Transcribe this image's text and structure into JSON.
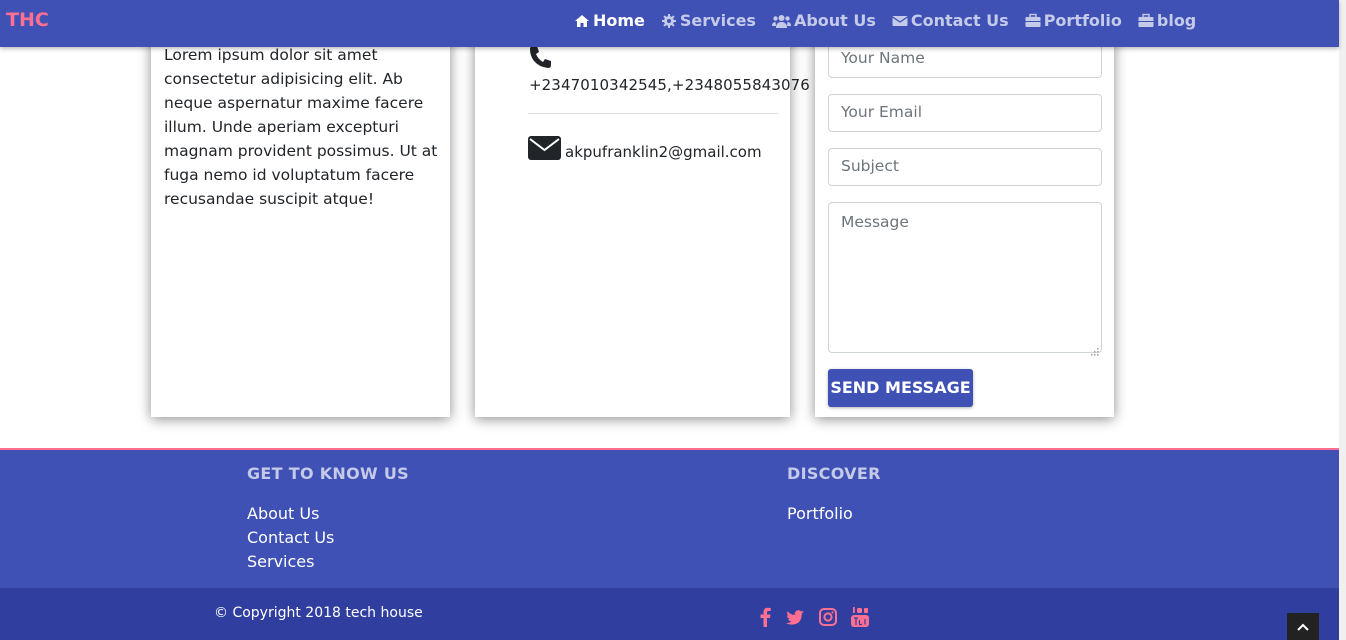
{
  "colors": {
    "primary": "#3f51b5",
    "primary_dark": "#303f9f",
    "accent": "#ff6f91",
    "nav_inactive": "#c5cae9"
  },
  "navbar": {
    "brand": "THC",
    "links": [
      {
        "label": "Home",
        "icon": "home-icon",
        "active": true
      },
      {
        "label": "Services",
        "icon": "gear-icon",
        "active": false
      },
      {
        "label": "About Us",
        "icon": "users-icon",
        "active": false
      },
      {
        "label": "Contact Us",
        "icon": "envelope-icon",
        "active": false
      },
      {
        "label": "Portfolio",
        "icon": "briefcase-icon",
        "active": false
      },
      {
        "label": "blog",
        "icon": "briefcase-icon",
        "active": false
      }
    ]
  },
  "about": {
    "text": "Lorem ipsum dolor sit amet consectetur adipisicing elit. Ab neque aspernatur maxime facere illum. Unde aperiam excepturi magnam provident possimus. Ut at fuga nemo id voluptatum facere recusandae suscipit atque!"
  },
  "contact": {
    "phone": "+2347010342545,+2348055843076",
    "email": "akpufranklin2@gmail.com"
  },
  "form": {
    "name_placeholder": "Your Name",
    "email_placeholder": "Your Email",
    "subject_placeholder": "Subject",
    "message_placeholder": "Message",
    "submit_label": "SEND MESSAGE"
  },
  "footer": {
    "col1": {
      "heading": "GET TO KNOW US",
      "links": [
        "About Us",
        "Contact Us",
        "Services"
      ]
    },
    "col2": {
      "heading": "DISCOVER",
      "links": [
        "Portfolio"
      ]
    },
    "copyright": "© Copyright 2018 tech house",
    "social": [
      "facebook-icon",
      "twitter-icon",
      "instagram-icon",
      "youtube-icon"
    ]
  }
}
